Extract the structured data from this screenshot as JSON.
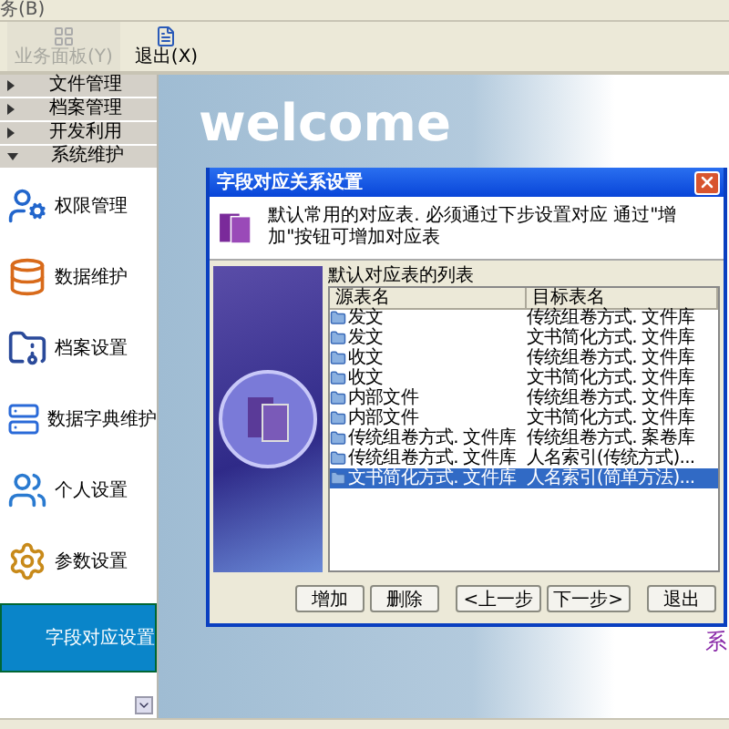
{
  "menu_bar": {
    "items": [
      "务(B)"
    ]
  },
  "toolbar": [
    {
      "label": "业务面板(Y)",
      "disabled": true
    },
    {
      "label": "退出(X)",
      "disabled": false
    }
  ],
  "sidebar": {
    "sections": [
      {
        "label": "文件管理",
        "expanded": false
      },
      {
        "label": "档案管理",
        "expanded": false
      },
      {
        "label": "开发利用",
        "expanded": false
      },
      {
        "label": "系统维护",
        "expanded": true
      }
    ],
    "items": [
      {
        "label": "权限管理",
        "selected": false
      },
      {
        "label": "数据维护",
        "selected": false
      },
      {
        "label": "档案设置",
        "selected": false
      },
      {
        "label": "数据字典维护",
        "selected": false
      },
      {
        "label": "个人设置",
        "selected": false
      },
      {
        "label": "参数设置",
        "selected": false
      },
      {
        "label": "字段对应设置",
        "selected": true
      }
    ]
  },
  "main": {
    "background_text": "welcome",
    "side_text": "系"
  },
  "dialog": {
    "title": "字段对应关系设置",
    "message": "默认常用的对应表. 必须通过下步设置对应 通过\"增加\"按钮可增加对应表",
    "list_caption": "默认对应表的列表",
    "table": {
      "columns": [
        "源表名",
        "目标表名"
      ],
      "rows": [
        {
          "source": "发文",
          "target": "传统组卷方式. 文件库",
          "selected": false
        },
        {
          "source": "发文",
          "target": "文书简化方式. 文件库",
          "selected": false
        },
        {
          "source": "收文",
          "target": "传统组卷方式. 文件库",
          "selected": false
        },
        {
          "source": "收文",
          "target": "文书简化方式. 文件库",
          "selected": false
        },
        {
          "source": "内部文件",
          "target": "传统组卷方式. 文件库",
          "selected": false
        },
        {
          "source": "内部文件",
          "target": "文书简化方式. 文件库",
          "selected": false
        },
        {
          "source": "传统组卷方式. 文件库",
          "target": "传统组卷方式. 案卷库",
          "selected": false
        },
        {
          "source": "传统组卷方式. 文件库",
          "target": "人名索引(传统方式)...",
          "selected": false
        },
        {
          "source": "文书简化方式. 文件库",
          "target": "人名索引(简单方法)...",
          "selected": true
        }
      ]
    },
    "buttons": [
      "增加",
      "删除",
      "<上一步",
      "下一步>",
      "退出"
    ]
  }
}
